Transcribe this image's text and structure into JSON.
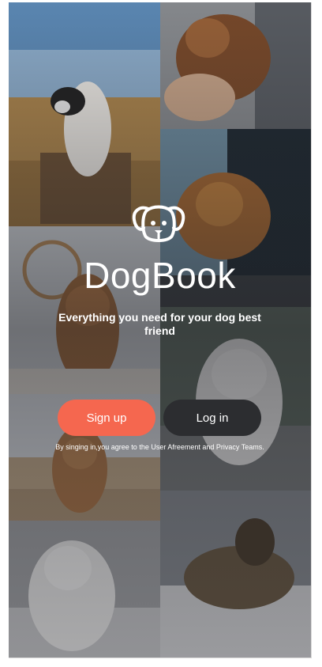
{
  "app": {
    "name": "DogBook",
    "logo_icon": "dog-face-icon"
  },
  "hero": {
    "tagline": "Everything you need for your dog best friend"
  },
  "actions": {
    "signup_label": "Sign up",
    "login_label": "Log in"
  },
  "legal": {
    "terms_text": "By singing in,you agree to the User Afreement and Privacy Teams."
  },
  "colors": {
    "accent": "#f5674f",
    "login_button": "#2c2d30",
    "text": "#ffffff"
  }
}
